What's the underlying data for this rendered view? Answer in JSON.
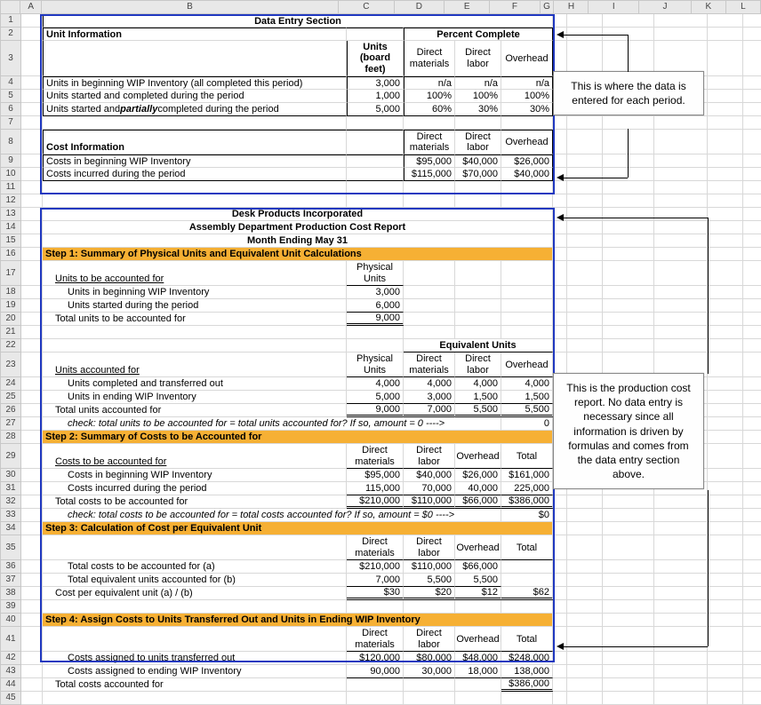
{
  "columns": [
    "A",
    "B",
    "C",
    "D",
    "E",
    "F",
    "G",
    "H",
    "I",
    "J",
    "K",
    "L"
  ],
  "s1": {
    "title": "Data Entry Section",
    "unitInfo": "Unit Information",
    "pc": "Percent Complete",
    "unitsHdr": "Units (board feet)",
    "dm": "Direct materials",
    "dl": "Direct labor",
    "oh": "Overhead",
    "rows": [
      {
        "label": "Units in beginning WIP Inventory (all completed this period)",
        "u": "3,000",
        "dm": "n/a",
        "dl": "n/a",
        "oh": "n/a"
      },
      {
        "label": "Units started and completed during the period",
        "u": "1,000",
        "dm": "100%",
        "dl": "100%",
        "oh": "100%"
      },
      {
        "label_pre": "Units started and ",
        "label_em": "partially",
        "label_post": " completed during the period",
        "u": "5,000",
        "dm": "60%",
        "dl": "30%",
        "oh": "30%"
      }
    ],
    "costInfo": "Cost Information",
    "crows": [
      {
        "label": "Costs in beginning WIP Inventory",
        "dm": "$95,000",
        "dl": "$40,000",
        "oh": "$26,000"
      },
      {
        "label": "Costs incurred during the period",
        "dm": "$115,000",
        "dl": "$70,000",
        "oh": "$40,000"
      }
    ]
  },
  "s2": {
    "t1": "Desk Products Incorporated",
    "t2": "Assembly Department Production Cost Report",
    "t3": "Month Ending May 31",
    "step1": "Step 1:  Summary of Physical Units and Equivalent Unit Calculations",
    "phu": "Physical Units",
    "acctFor": "Units to be accounted for",
    "r18": {
      "label": "Units in beginning WIP Inventory",
      "v": "3,000"
    },
    "r19": {
      "label": "Units started during the period",
      "v": "6,000"
    },
    "r20": {
      "label": "Total units to be accounted for",
      "v": "9,000"
    },
    "equ": "Equivalent Units",
    "dm": "Direct materials",
    "dl": "Direct labor",
    "oh": "Overhead",
    "uacct": "Units accounted for",
    "r24": {
      "label": "Units completed and transferred out",
      "pu": "4,000",
      "dm": "4,000",
      "dl": "4,000",
      "oh": "4,000"
    },
    "r25": {
      "label": "Units in ending WIP Inventory",
      "pu": "5,000",
      "dm": "3,000",
      "dl": "1,500",
      "oh": "1,500"
    },
    "r26": {
      "label": "Total units accounted for",
      "pu": "9,000",
      "dm": "7,000",
      "dl": "5,500",
      "oh": "5,500"
    },
    "r27": {
      "label": "check:  total units to be accounted for = total units accounted for?  If so, amount = 0 ---->",
      "v": "0"
    },
    "step2": "Step 2:  Summary of Costs to be Accounted for",
    "total": "Total",
    "cacct": "Costs to be accounted for",
    "r30": {
      "label": "Costs in beginning WIP Inventory",
      "dm": "$95,000",
      "dl": "$40,000",
      "oh": "$26,000",
      "t": "$161,000"
    },
    "r31": {
      "label": "Costs incurred during the period",
      "dm": "115,000",
      "dl": "70,000",
      "oh": "40,000",
      "t": "225,000"
    },
    "r32": {
      "label": "Total costs to be accounted for",
      "dm": "$210,000",
      "dl": "$110,000",
      "oh": "$66,000",
      "t": "$386,000"
    },
    "r33": {
      "label": "check:  total costs to be accounted for = total costs accounted for?  If so, amount = $0 ---->",
      "v": "$0"
    },
    "step3": "Step 3:  Calculation of Cost per Equivalent Unit",
    "r36": {
      "label": "Total costs to be accounted for (a)",
      "dm": "$210,000",
      "dl": "$110,000",
      "oh": "$66,000"
    },
    "r37": {
      "label": "Total equivalent units accounted for (b)",
      "dm": "7,000",
      "dl": "5,500",
      "oh": "5,500"
    },
    "r38": {
      "label": "Cost per equivalent unit (a) / (b)",
      "dm": "$30",
      "dl": "$20",
      "oh": "$12",
      "t": "$62"
    },
    "step4": "Step 4:  Assign Costs to Units Transferred Out and Units in Ending WIP Inventory",
    "r42": {
      "label": "Costs assigned to units transferred out",
      "dm": "$120,000",
      "dl": "$80,000",
      "oh": "$48,000",
      "t": "$248,000"
    },
    "r43": {
      "label": "Costs assigned to ending WIP Inventory",
      "dm": "90,000",
      "dl": "30,000",
      "oh": "18,000",
      "t": "138,000"
    },
    "r44": {
      "label": "Total costs accounted for",
      "t": "$386,000"
    }
  },
  "callouts": {
    "c1": "This is where the data is entered for each period.",
    "c2": "This is the production cost report. No data entry is necessary since all information is driven by formulas and comes from the data entry section above."
  },
  "rowHeights": {
    "default": 15,
    "r3": 40,
    "r8": 28,
    "r17": 28,
    "r23": 28,
    "r29": 28,
    "r35": 28,
    "r41": 28
  }
}
